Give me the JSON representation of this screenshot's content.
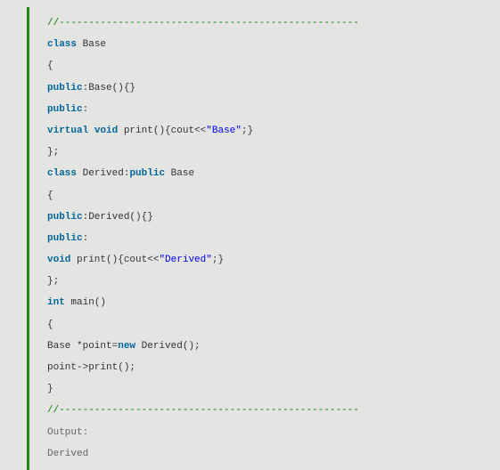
{
  "sep1": "//---------------------------------------------------",
  "l1_kw": "class",
  "l1_rest": " Base",
  "l2": "{",
  "l3_kw": "public",
  "l3_rest": ":Base(){}",
  "l4_kw": "public",
  "l4_rest": ":",
  "l5_kw1": "virtual",
  "l5_sp1": " ",
  "l5_kw2": "void",
  "l5_mid": " print(){cout<<",
  "l5_str": "\"Base\"",
  "l5_end": ";}",
  "l6": "};",
  "l7_kw1": "class",
  "l7_mid": " Derived:",
  "l7_kw2": "public",
  "l7_end": " Base",
  "l8": "{",
  "l9_kw": "public",
  "l9_rest": ":Derived(){}",
  "l10_kw": "public",
  "l10_rest": ":",
  "l11_kw": "void",
  "l11_mid": " print(){cout<<",
  "l11_str": "\"Derived\"",
  "l11_end": ";}",
  "l12": "};",
  "l13_kw": "int",
  "l13_rest": " main()",
  "l14": "{",
  "l15_a": "Base *point=",
  "l15_kw": "new",
  "l15_b": " Derived();",
  "l16": "point->print();",
  "l17": "}",
  "sep2": "//---------------------------------------------------",
  "out_label": "Output:",
  "out_value": "Derived"
}
